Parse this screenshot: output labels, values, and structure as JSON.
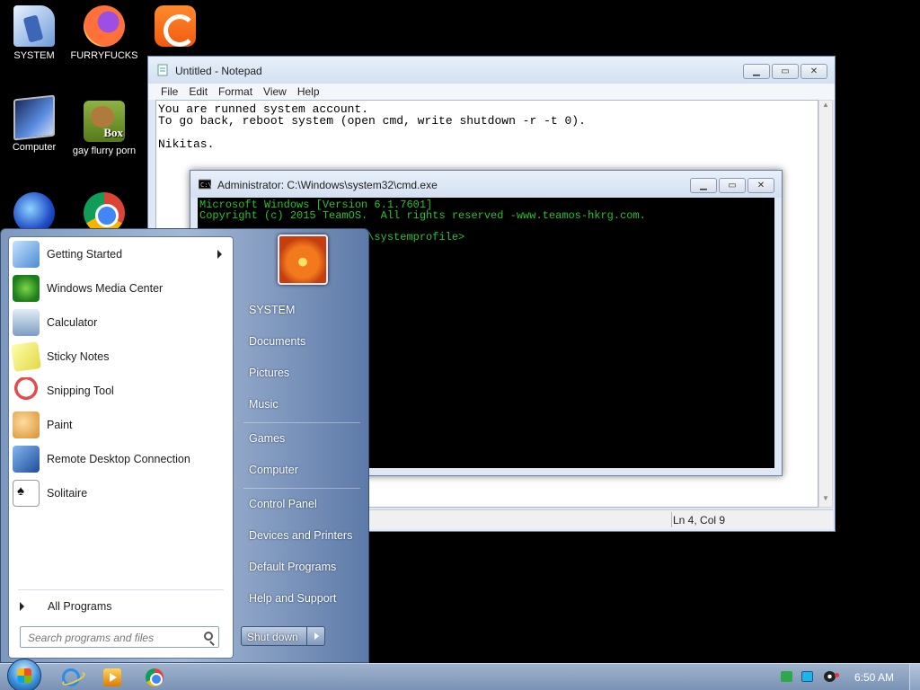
{
  "desktop": {
    "icons": [
      {
        "label": "SYSTEM",
        "icon": "system-icon"
      },
      {
        "label": "FURRYFUCKS",
        "icon": "firefox-icon"
      },
      {
        "label": "",
        "icon": "uc-browser-icon"
      },
      {
        "label": "Computer",
        "icon": "computer-icon"
      },
      {
        "label": "gay flurry porn",
        "icon": "box-app-icon"
      },
      {
        "label": "",
        "icon": "orb-app-icon"
      },
      {
        "label": "",
        "icon": "chrome-icon"
      }
    ],
    "box_icon_text": "Box"
  },
  "notepad": {
    "title": "Untitled - Notepad",
    "menu": [
      "File",
      "Edit",
      "Format",
      "View",
      "Help"
    ],
    "content": "You are runned system account.\nTo go back, reboot system (open cmd, write shutdown -r -t 0).\n\nNikitas.",
    "status_position": "Ln 4, Col 9"
  },
  "cmd": {
    "title": "Administrator: C:\\Windows\\system32\\cmd.exe",
    "content": "Microsoft Windows [Version 6.1.7601]\nCopyright (c) 2015 TeamOS.  All rights reserved -www.teamos-hkrg.com.\n\nC:\\Windows\\system32\\config\\systemprofile>"
  },
  "start_menu": {
    "programs": [
      {
        "label": "Getting Started",
        "icon": "getting-started-icon",
        "has_submenu": true
      },
      {
        "label": "Windows Media Center",
        "icon": "media-center-icon",
        "has_submenu": false
      },
      {
        "label": "Calculator",
        "icon": "calculator-icon",
        "has_submenu": false
      },
      {
        "label": "Sticky Notes",
        "icon": "sticky-notes-icon",
        "has_submenu": false
      },
      {
        "label": "Snipping Tool",
        "icon": "snipping-tool-icon",
        "has_submenu": false
      },
      {
        "label": "Paint",
        "icon": "paint-icon",
        "has_submenu": false
      },
      {
        "label": "Remote Desktop Connection",
        "icon": "remote-desktop-icon",
        "has_submenu": false
      },
      {
        "label": "Solitaire",
        "icon": "solitaire-icon",
        "has_submenu": false
      }
    ],
    "all_programs": "All Programs",
    "search_placeholder": "Search programs and files",
    "right_links": [
      "SYSTEM",
      "Documents",
      "Pictures",
      "Music",
      "Games",
      "Computer",
      "Control Panel",
      "Devices and Printers",
      "Default Programs",
      "Help and Support"
    ],
    "shutdown_label": "Shut down"
  },
  "taskbar": {
    "pinned": [
      "internet-explorer-icon",
      "media-player-icon",
      "chrome-icon"
    ],
    "tray": [
      "network-icon",
      "display-icon",
      "volume-icon"
    ],
    "clock": "6:50 AM"
  }
}
